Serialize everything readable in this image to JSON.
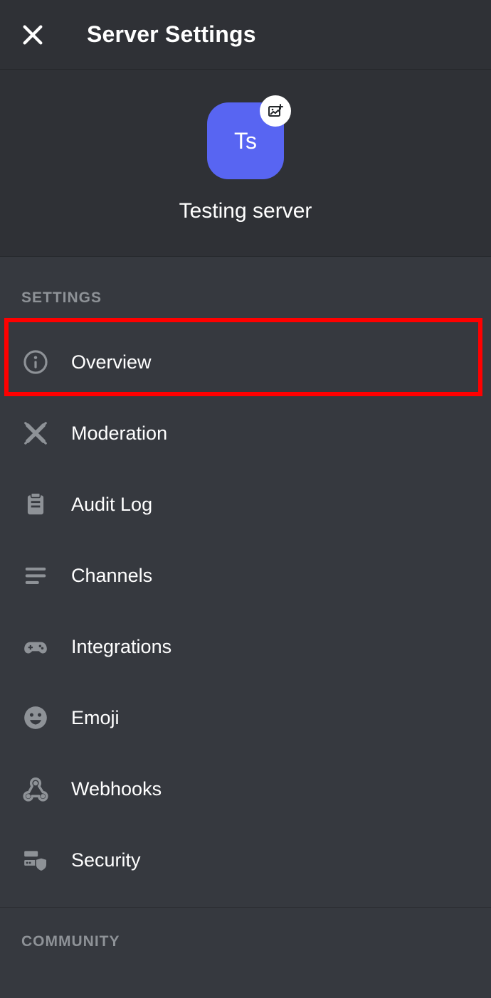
{
  "header": {
    "title": "Server Settings"
  },
  "server": {
    "initials": "Ts",
    "name": "Testing server"
  },
  "sections": {
    "settings_header": "SETTINGS",
    "community_header": "COMMUNITY"
  },
  "menu": {
    "overview": "Overview",
    "moderation": "Moderation",
    "audit_log": "Audit Log",
    "channels": "Channels",
    "integrations": "Integrations",
    "emoji": "Emoji",
    "webhooks": "Webhooks",
    "security": "Security"
  }
}
